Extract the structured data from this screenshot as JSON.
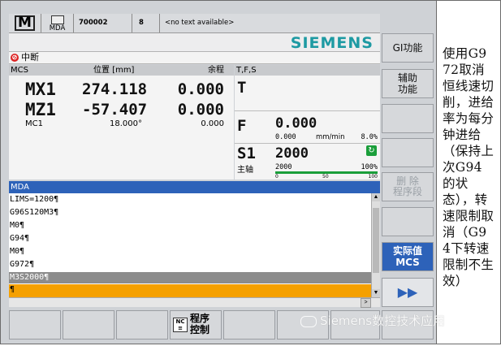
{
  "top": {
    "mode_icon": "M",
    "mda_label": "MDA",
    "program_number": "700002",
    "channel": "8",
    "message": "<no text available>"
  },
  "logo": "SIEMENS",
  "alarm": {
    "text": "中断"
  },
  "mcs": {
    "header_label": "MCS",
    "header_pos": "位置 [mm]",
    "header_rest": "余程",
    "axes": [
      {
        "name": "MX1",
        "pos": "274.118",
        "rest": "0.000"
      },
      {
        "name": "MZ1",
        "pos": "-57.407",
        "rest": "0.000"
      }
    ],
    "mc1": {
      "name": "MC1",
      "pos": "18.000°",
      "rest": "0.000"
    }
  },
  "tfs": {
    "header": "T,F,S",
    "t_label": "T",
    "f_label": "F",
    "f_value": "0.000",
    "f_actual": "0.000",
    "f_unit": "mm/min",
    "f_percent": "8.0%",
    "s_label": "S1",
    "s_value": "2000",
    "spindle_label": "主轴",
    "s_actual": "2000",
    "s_percent": "100%",
    "scale": [
      "0",
      "50",
      "100"
    ],
    "spindle_load": 1.0
  },
  "mda": {
    "header": "MDA",
    "lines": [
      "LIMS=1200¶",
      "G96S120M3¶",
      "M0¶",
      "G94¶",
      "M0¶",
      "G972¶",
      "M3S2000¶",
      "¶"
    ]
  },
  "vsoftkeys": [
    "GI功能",
    "辅助\n功能",
    "",
    "",
    "",
    "删 除\n程序段",
    "",
    "实际值\nMCS",
    "▶▶"
  ],
  "hsoftkeys": [
    "",
    "",
    "",
    "程序\n控制",
    "",
    "",
    "",
    ""
  ],
  "side_text": "使用G972取消恒线速切削，进给率为每分钟进给（保持上次G94的状态），转速限制取消（G94下转速限制不生效）",
  "watermark": "Siemens数控技术应用",
  "colors": {
    "mda_header": "#2d62b9",
    "current_line": "#f5a000",
    "actual_mcs_button": "#2d62b9",
    "logo": "#1e9aa3",
    "spindle_ok": "#1a9e3a"
  }
}
